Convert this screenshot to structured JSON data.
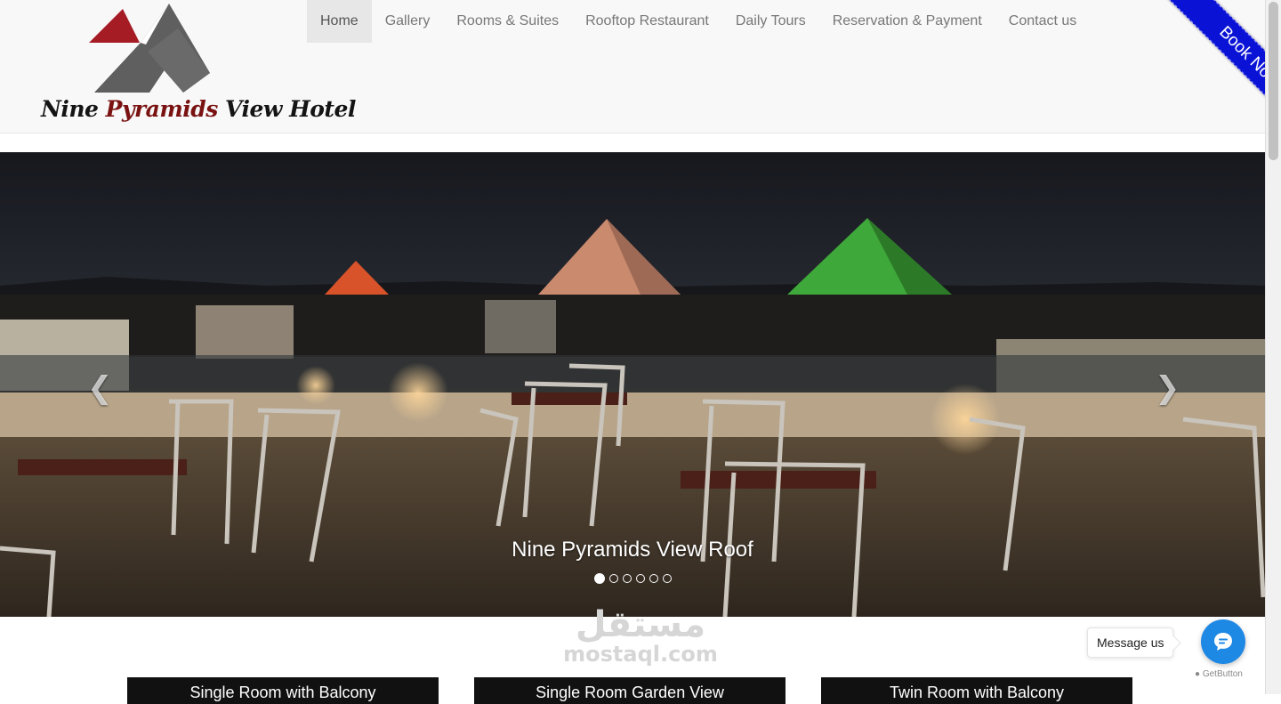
{
  "header": {
    "logo_text_part1": "Nine ",
    "logo_text_part2": "Pyramids",
    "logo_text_part3": " View Hotel",
    "logo_colors": {
      "red": "#a51c24",
      "gray": "#5f5f5f",
      "text_dark": "#141414",
      "text_red": "#7a1212"
    },
    "nav": [
      {
        "label": "Home",
        "active": true
      },
      {
        "label": "Gallery"
      },
      {
        "label": "Rooms & Suites"
      },
      {
        "label": "Rooftop Restaurant"
      },
      {
        "label": "Daily Tours"
      },
      {
        "label": "Reservation & Payment"
      },
      {
        "label": "Contact us"
      }
    ],
    "ribbon_label": "Book Now",
    "ribbon_color": "#0a12d6"
  },
  "slider": {
    "caption": "Nine Pyramids View Roof",
    "slide_count": 6,
    "active_slide": 1,
    "prev_icon": "chevron-left-icon",
    "next_icon": "chevron-right-icon"
  },
  "watermark": {
    "arabic": "مستقل",
    "latin": "mostaql.com"
  },
  "cards": [
    {
      "label": "Single Room with Balcony"
    },
    {
      "label": "Single Room Garden View"
    },
    {
      "label": "Twin Room with Balcony"
    }
  ],
  "messenger": {
    "bubble_label": "Message us",
    "icon": "chat-icon",
    "color": "#1e88e5",
    "credit": "GetButton"
  }
}
